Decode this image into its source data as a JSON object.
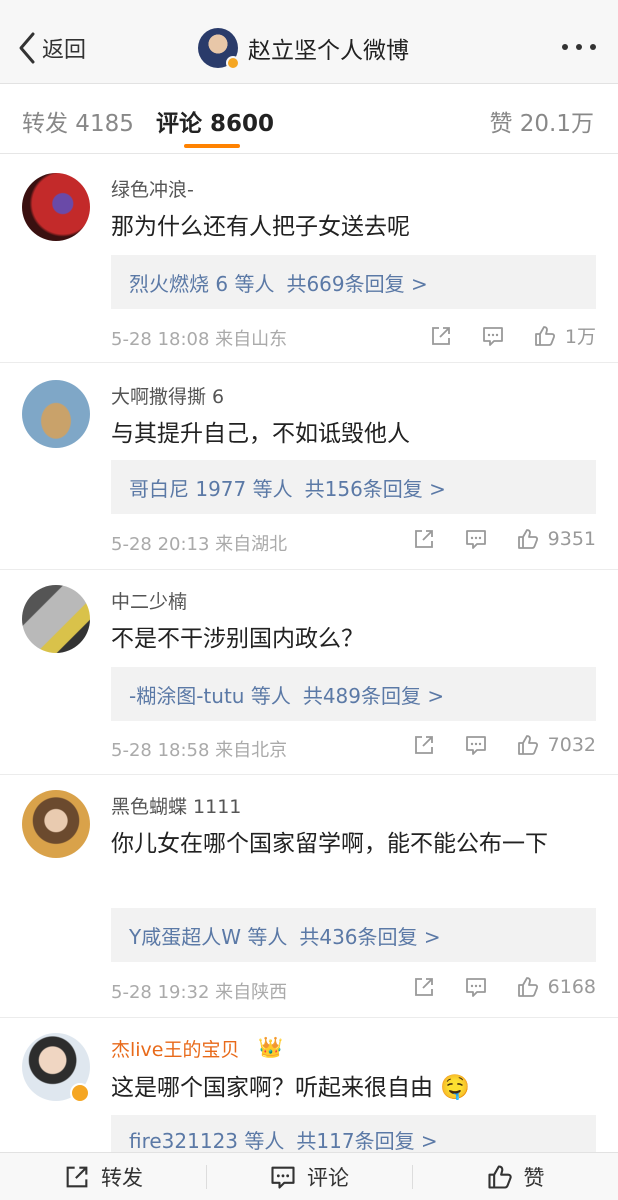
{
  "nav": {
    "back_label": "返回",
    "title": "赵立坚个人微博"
  },
  "tabs": {
    "repost": "转发 4185",
    "comment": "评论 8600",
    "like": "赞 20.1万"
  },
  "comments": [
    {
      "name": "绿色冲浪-",
      "text": "那为什么还有人把子女送去呢",
      "reply_who": "烈火燃烧 6 等人",
      "reply_count": "共669条回复 >",
      "meta": "5-28 18:08  来自山东",
      "likes": "1万"
    },
    {
      "name": "大啊撒得撕 6",
      "text": "与其提升自己，不如诋毁他人",
      "reply_who": "哥白尼 1977 等人",
      "reply_count": "共156条回复 >",
      "meta": "5-28 20:13  来自湖北",
      "likes": "9351"
    },
    {
      "name": "中二少楠",
      "text": "不是不干涉别国内政么？",
      "reply_who": "-糊涂图-tutu 等人",
      "reply_count": "共489条回复 >",
      "meta": "5-28 18:58  来自北京",
      "likes": "7032"
    },
    {
      "name": "黑色蝴蝶 1111",
      "text": "你儿女在哪个国家留学啊，能不能公布一下",
      "reply_who": "Y咸蛋超人W 等人",
      "reply_count": "共436条回复 >",
      "meta": "5-28 19:32  来自陕西",
      "likes": "6168"
    },
    {
      "name": "杰live王的宝贝",
      "text": "这是哪个国家啊？听起来很自由",
      "reply_who": "fire321123 等人",
      "reply_count": "共117条回复 >"
    }
  ],
  "bottom": {
    "repost": "转发",
    "comment": "评论",
    "like": "赞"
  },
  "colors": {
    "accent": "#ff8200",
    "link": "#5b79a6"
  }
}
